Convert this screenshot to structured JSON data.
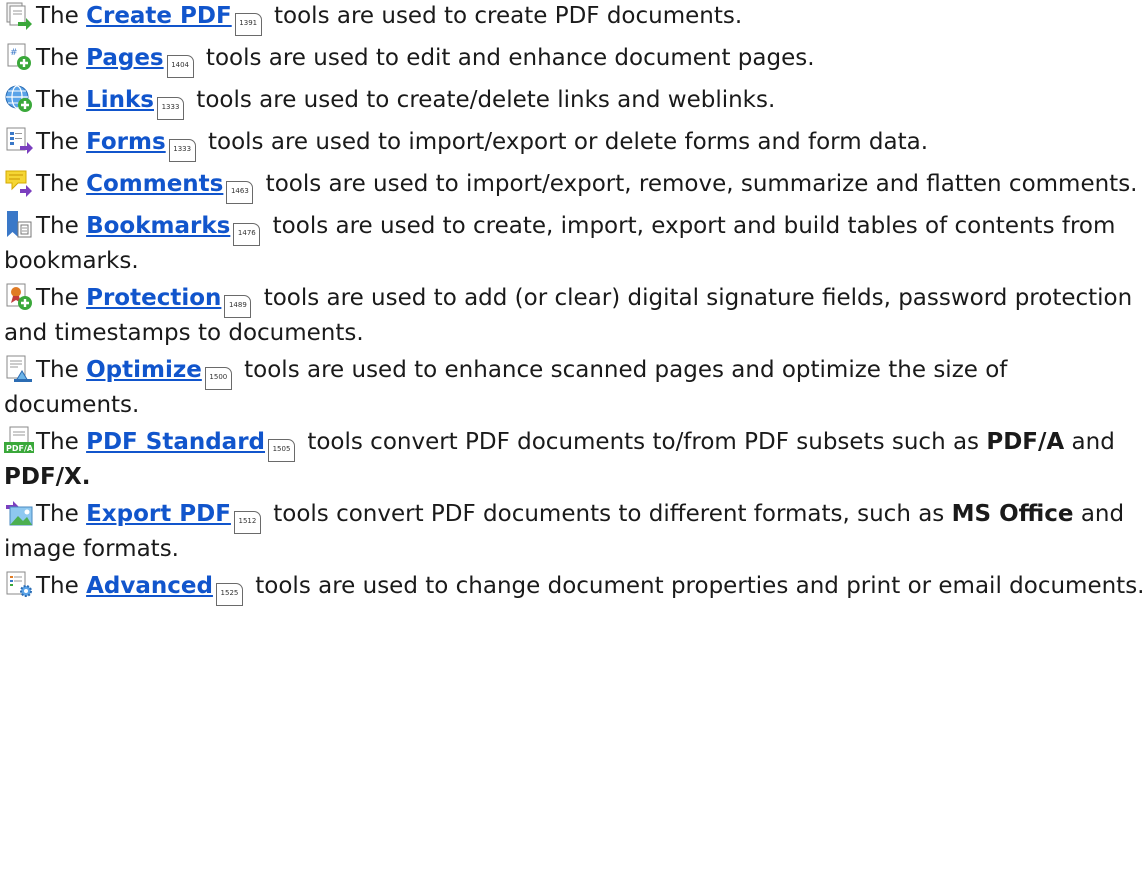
{
  "items": [
    {
      "icon": "create-pdf-icon",
      "pre": "The ",
      "link": "Create PDF",
      "ref": "1391",
      "text": " tools are used to create PDF documents."
    },
    {
      "icon": "pages-icon",
      "pre": "The ",
      "link": "Pages",
      "ref": "1404",
      "text": " tools are used to edit and enhance document pages."
    },
    {
      "icon": "links-icon",
      "pre": "The ",
      "link": "Links",
      "ref": "1333",
      "text": " tools are used to create/delete links and weblinks."
    },
    {
      "icon": "forms-icon",
      "pre": "The ",
      "link": "Forms",
      "ref": "1333",
      "text": " tools are used to import/export or delete forms and form data."
    },
    {
      "icon": "comments-icon",
      "pre": "The ",
      "link": "Comments",
      "ref": "1463",
      "text": " tools are used to import/export, remove, summarize and flatten comments."
    },
    {
      "icon": "bookmarks-icon",
      "pre": "The ",
      "link": "Bookmarks",
      "ref": "1476",
      "text": " tools are used to create, import, export and build tables of contents from bookmarks."
    },
    {
      "icon": "protection-icon",
      "pre": "The ",
      "link": "Protection",
      "ref": "1489",
      "text": " tools are used to add (or clear) digital signature fields, password protection and timestamps to documents."
    },
    {
      "icon": "optimize-icon",
      "pre": "The ",
      "link": "Optimize",
      "ref": "1500",
      "text": " tools are used to enhance scanned pages and optimize the size of documents."
    },
    {
      "icon": "pdf-standard-icon",
      "pre": "The ",
      "link": "PDF Standard",
      "ref": "1505",
      "text": " tools convert PDF documents to/from PDF subsets such as ",
      "b1": "PDF/A",
      "mid": " and ",
      "b2": "PDF/X.",
      "tail": ""
    },
    {
      "icon": "export-pdf-icon",
      "pre": "The ",
      "link": "Export PDF",
      "ref": "1512",
      "text": " tools convert PDF documents to different formats, such as ",
      "b1": "MS Office",
      "mid": " and image formats.",
      "b2": "",
      "tail": ""
    },
    {
      "icon": "advanced-icon",
      "pre": "The ",
      "link": "Advanced",
      "ref": "1525",
      "text": " tools are used to change document properties and print or email documents."
    }
  ],
  "colors": {
    "link": "#1155cc",
    "text": "#1a1a1a"
  }
}
